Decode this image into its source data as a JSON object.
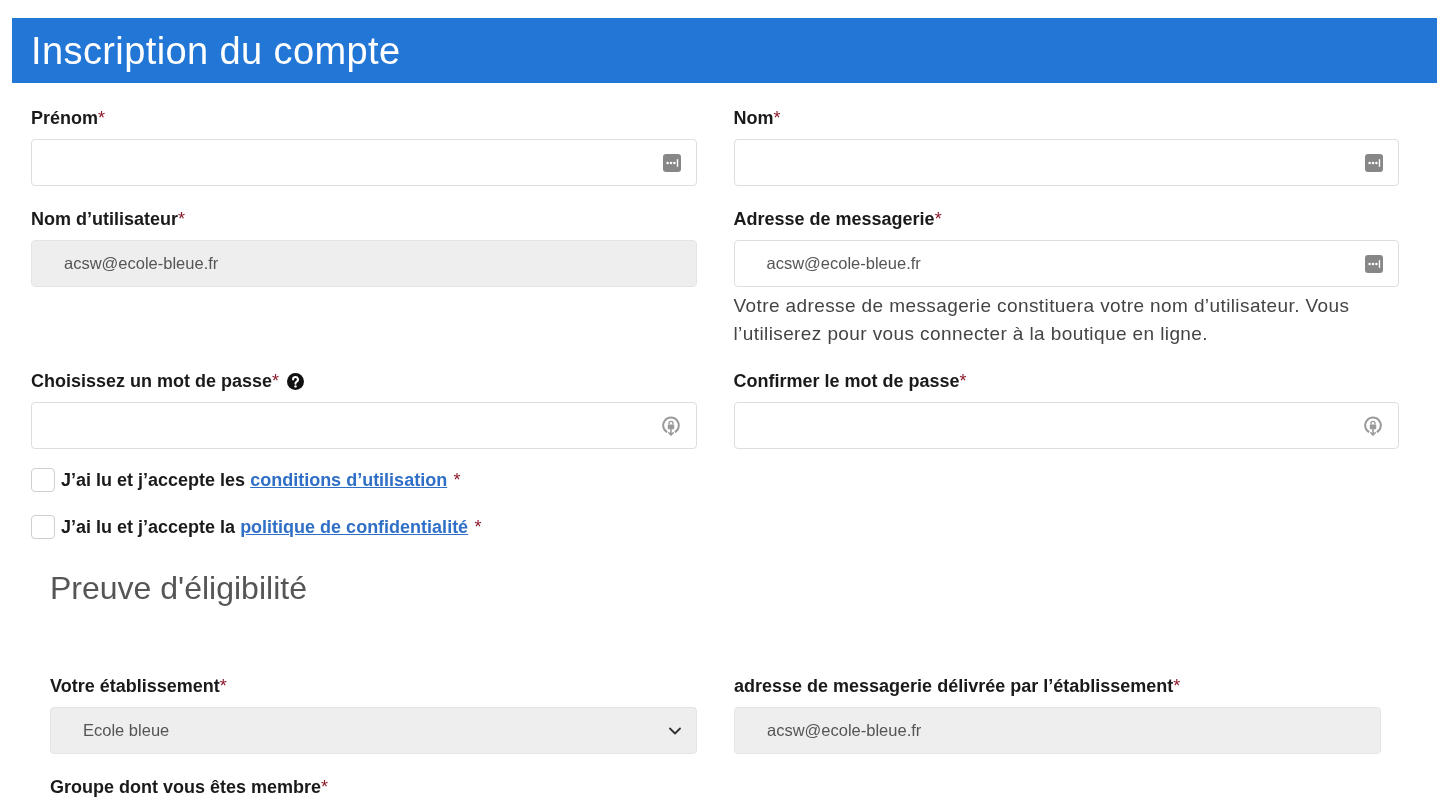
{
  "header": {
    "title": "Inscription du compte"
  },
  "account_fields": [
    {
      "label": "Prénom",
      "required_mark": "*",
      "help_icon": false,
      "kind": "text",
      "disabled": false
    },
    {
      "label": "Nom",
      "required_mark": "*",
      "help_icon": false,
      "kind": "text",
      "disabled": false
    },
    {
      "label": "Nom d’utilisateur",
      "required_mark": "*",
      "help_icon": false,
      "kind": "text",
      "disabled": true,
      "value": "acsw@ecole-bleue.fr"
    },
    {
      "label": "Adresse de messagerie",
      "required_mark": "*",
      "help_icon": false,
      "kind": "text",
      "disabled": false,
      "value": "acsw@ecole-bleue.fr",
      "help": "Votre adresse de messagerie constituera votre nom d’utilisateur. Vous l’utiliserez pour vous connecter à la boutique en ligne."
    },
    {
      "label": "Choisissez un mot de passe",
      "required_mark": "*",
      "help_icon": true,
      "kind": "password",
      "disabled": false
    },
    {
      "label": "Confirmer le mot de passe",
      "required_mark": "*",
      "help_icon": false,
      "kind": "password",
      "disabled": false
    }
  ],
  "agreements": [
    {
      "text": "J’ai lu et j’accepte les",
      "link": "conditions d’utilisation",
      "required_mark": "*",
      "checked": false
    },
    {
      "text": "J’ai lu et j’accepte la",
      "link": "politique de confidentialité",
      "required_mark": "*",
      "checked": false
    }
  ],
  "eligibility": {
    "title": "Preuve d'éligibilité",
    "fields": [
      {
        "label": "Votre établissement",
        "required_mark": "*",
        "help_icon": false,
        "kind": "select",
        "disabled": true,
        "value": "Ecole bleue"
      },
      {
        "label": "adresse de messagerie délivrée par l’établissement",
        "required_mark": "*",
        "help_icon": false,
        "kind": "text",
        "disabled": true,
        "value": "acsw@ecole-bleue.fr"
      },
      {
        "label": "Groupe dont vous êtes membre",
        "required_mark": "*",
        "help_icon": false
      }
    ]
  }
}
